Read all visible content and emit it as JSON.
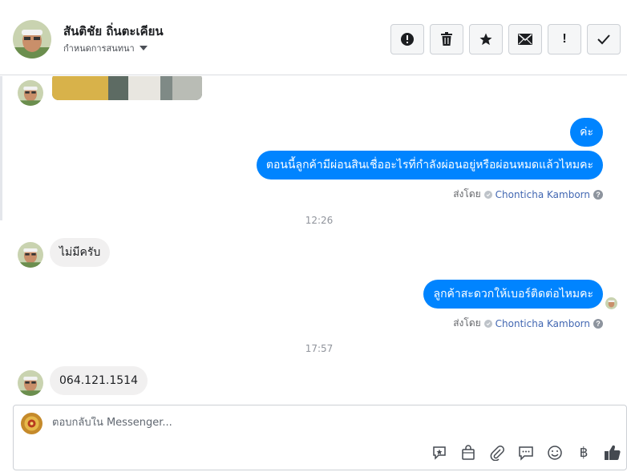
{
  "header": {
    "contact_name": "สันติชัย ถิ่นตะเคียน",
    "tag_label": "กำหนดการสนทนา",
    "actions": [
      {
        "name": "report-button",
        "icon": "alert-circle-icon"
      },
      {
        "name": "delete-button",
        "icon": "trash-icon"
      },
      {
        "name": "star-button",
        "icon": "star-icon"
      },
      {
        "name": "mark-unread-button",
        "icon": "envelope-icon"
      },
      {
        "name": "mark-spam-button",
        "icon": "exclamation-icon",
        "text": "!"
      },
      {
        "name": "mark-done-button",
        "icon": "check-icon"
      }
    ]
  },
  "messages": {
    "out1": "ค่ะ",
    "out2": "ตอนนี้ลูกค้ามีผ่อนสินเชื่ออะไรที่กำลังผ่อนอยู่หรือผ่อนหมดแล้วไหมคะ",
    "sentby_label_1": "ส่งโดย",
    "sender_1": "Chonticha Kamborn",
    "time_1": "12:26",
    "in1": "ไม่มีครับ",
    "out3": "ลูกค้าสะดวกให้เบอร์ติดต่อไหมคะ",
    "sentby_label_2": "ส่งโดย",
    "sender_2": "Chonticha Kamborn",
    "time_2": "17:57",
    "in2": "064.121.1514",
    "help_glyph": "?"
  },
  "composer": {
    "placeholder": "ตอบกลับใน Messenger...",
    "tools": [
      "saved-reply-icon",
      "shop-bag-icon",
      "paperclip-icon",
      "chat-bubble-icon",
      "emoji-icon",
      "baht-icon",
      "thumbs-up-icon"
    ],
    "baht_glyph": "฿"
  },
  "colors": {
    "outgoing_bubble": "#0084ff",
    "incoming_bubble": "#f1f0f0",
    "sender_link": "#4267b2"
  }
}
